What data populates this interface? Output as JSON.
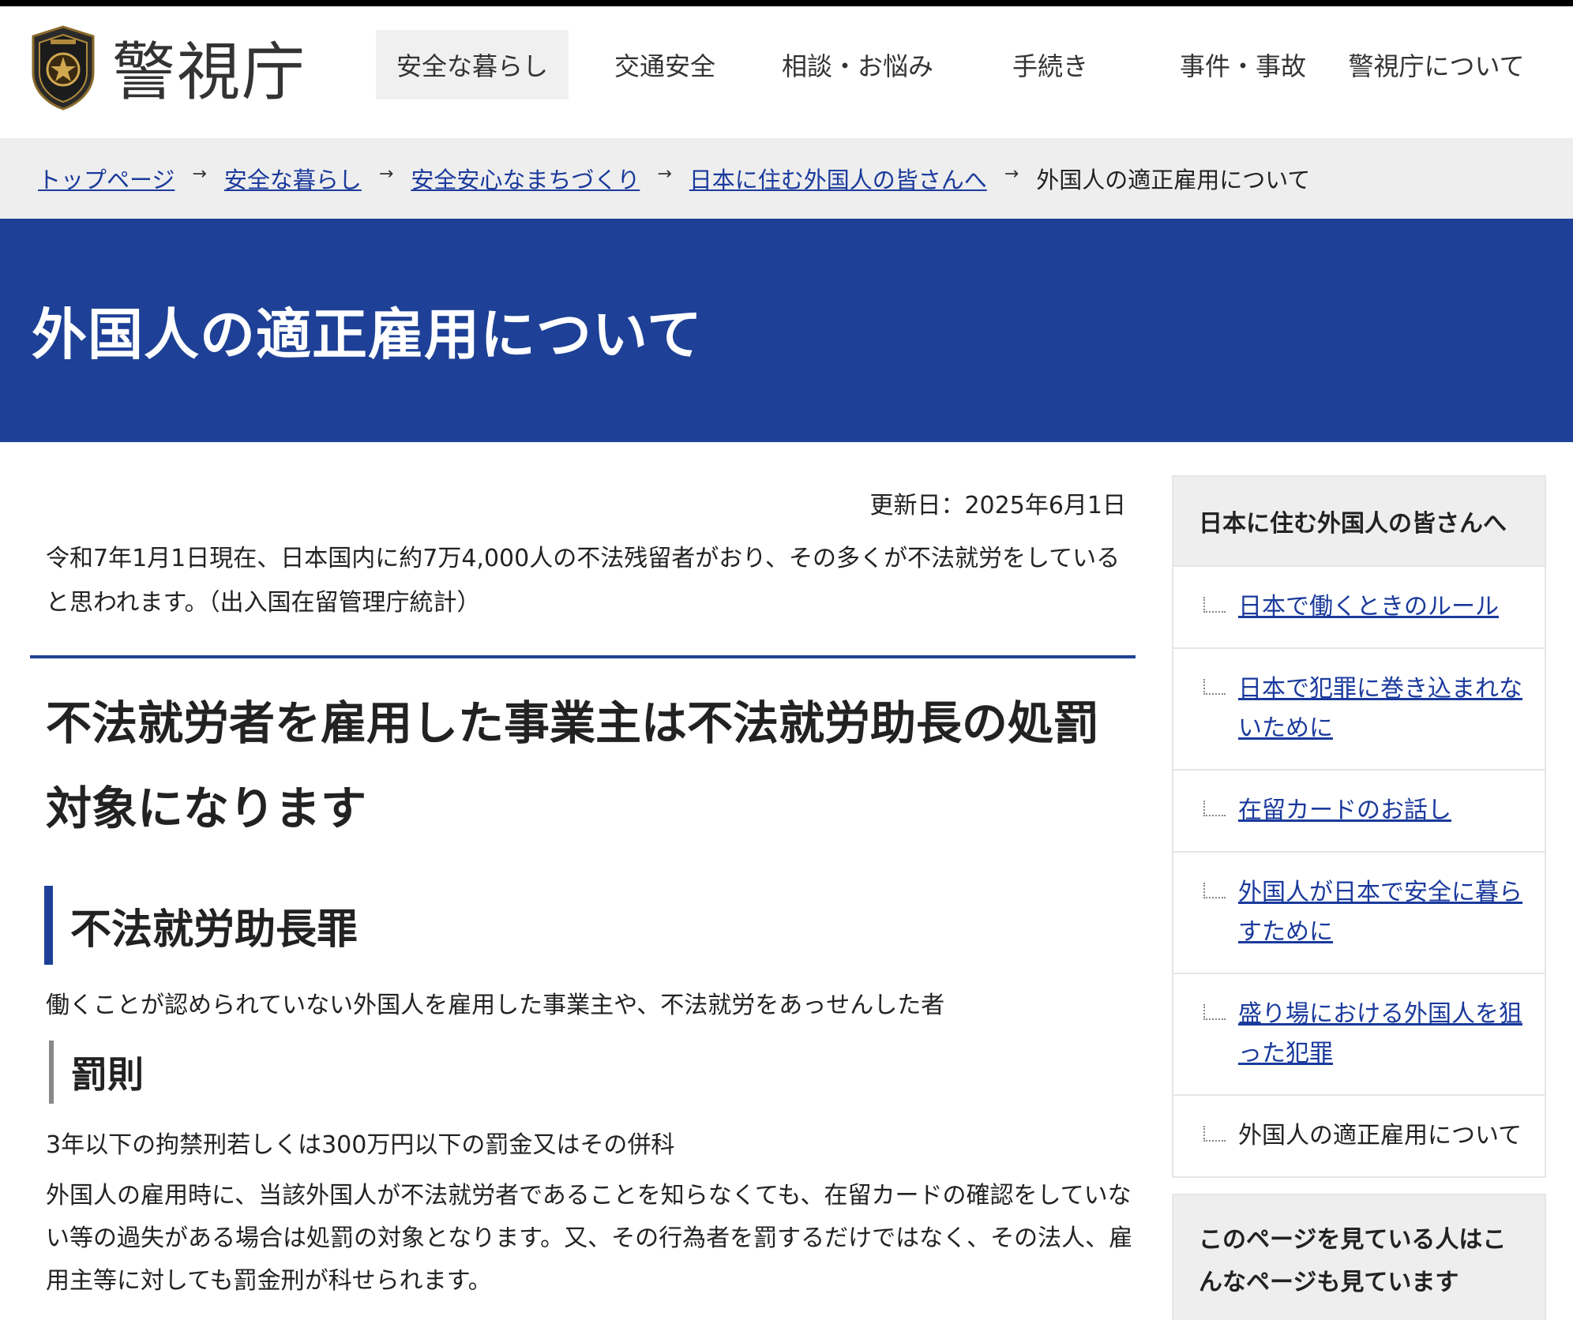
{
  "header": {
    "site_name": "警視庁",
    "nav": [
      {
        "label": "安全な暮らし",
        "active": true
      },
      {
        "label": "交通安全",
        "active": false
      },
      {
        "label": "相談・お悩み",
        "active": false
      },
      {
        "label": "手続き",
        "active": false
      },
      {
        "label": "事件・事故",
        "active": false
      },
      {
        "label": "警視庁について",
        "active": false
      }
    ]
  },
  "breadcrumb": {
    "items": [
      "トップページ",
      "安全な暮らし",
      "安全安心なまちづくり",
      "日本に住む外国人の皆さんへ"
    ],
    "current": "外国人の適正雇用について",
    "arrow": "→"
  },
  "page": {
    "title": "外国人の適正雇用について",
    "updated": "更新日：2025年6月1日",
    "intro": "令和7年1月1日現在、日本国内に約7万4,000人の不法残留者がおり、その多くが不法就労をしていると思われます。（出入国在留管理庁統計）",
    "h2": "不法就労者を雇用した事業主は不法就労助長の処罰対象になります",
    "h3": "不法就労助長罪",
    "h3_desc": "働くことが認められていない外国人を雇用した事業主や、不法就労をあっせんした者",
    "h4": "罰則",
    "penalty": "3年以下の拘禁刑若しくは300万円以下の罰金又はその併科",
    "note": "外国人の雇用時に、当該外国人が不法就労者であることを知らなくても、在留カードの確認をしていない等の過失がある場合は処罰の対象となります。又、その行為者を罰するだけではなく、その法人、雇用主等に対しても罰金刑が科せられます。"
  },
  "sidebar": {
    "title": "日本に住む外国人の皆さんへ",
    "items": [
      {
        "label": "日本で働くときのルール",
        "current": false
      },
      {
        "label": "日本で犯罪に巻き込まれないために",
        "current": false
      },
      {
        "label": "在留カードのお話し",
        "current": false
      },
      {
        "label": "外国人が日本で安全に暮らすために",
        "current": false
      },
      {
        "label": "盛り場における外国人を狙った犯罪",
        "current": false
      },
      {
        "label": "外国人の適正雇用について",
        "current": true
      }
    ],
    "related_title": "このページを見ている人はこんなページも見ています"
  },
  "colors": {
    "banner": "#1e4197",
    "link": "#1a3a9c",
    "breadcrumb_bg": "#eeeeee"
  }
}
